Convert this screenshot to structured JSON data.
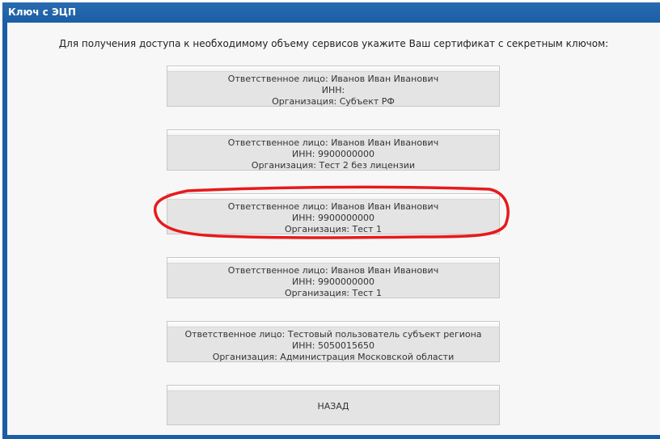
{
  "window": {
    "title": "Ключ с ЭЦП"
  },
  "instruction": "Для получения доступа к необходимому объему сервисов укажите Ваш сертификат с секретным ключом:",
  "certificates": [
    {
      "person": "Ответственное лицо: Иванов Иван Иванович",
      "inn": "ИНН:",
      "org": "Организация: Субъект РФ"
    },
    {
      "person": "Ответственное лицо: Иванов Иван Иванович",
      "inn": "ИНН: 9900000000",
      "org": "Организация: Тест 2 без лицензии"
    },
    {
      "person": "Ответственное лицо: Иванов Иван Иванович",
      "inn": "ИНН: 9900000000",
      "org": "Организация: Тест 1"
    },
    {
      "person": "Ответственное лицо: Иванов Иван Иванович",
      "inn": "ИНН: 9900000000",
      "org": "Организация: Тест 1"
    },
    {
      "person": "Ответственное лицо: Тестовый пользователь субъект региона",
      "inn": "ИНН: 5050015650",
      "org": "Организация: Администрация Московской области"
    }
  ],
  "back_label": "НАЗАД",
  "colors": {
    "title_bar": "#1a5ea6",
    "highlight": "#e8191b"
  }
}
